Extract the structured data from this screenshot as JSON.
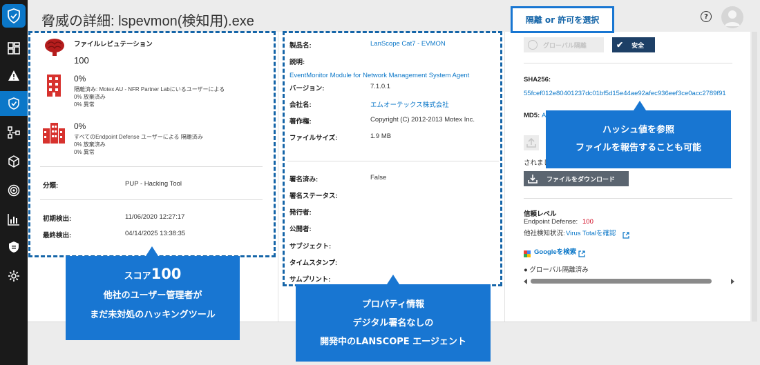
{
  "page": {
    "title": "脅威の詳細: lspevmon(検知用).exe"
  },
  "left_panel": {
    "reputation_title": "ファイルレピュテーション",
    "score": "100",
    "partner": {
      "percent": "0%",
      "desc": "隔離済み: Motex AU - NFR Partner Labにいるユーザーによる",
      "allowed": "0% 放棄済み",
      "anomaly": "0% 異常"
    },
    "all_users": {
      "percent": "0%",
      "desc": "すべてのEndpoint Defense ユーザーによる 隔離済み",
      "allowed": "0% 放棄済み",
      "anomaly": "0% 異常"
    },
    "classification_label": "分類:",
    "classification_value": "PUP - Hacking Tool",
    "first_seen_label": "初期検出:",
    "first_seen_value": "11/06/2020 12:27:17",
    "last_seen_label": "最終検出:",
    "last_seen_value": "04/14/2025 13:38:35"
  },
  "middle_panel": {
    "product_label": "製品名:",
    "product_value": "LanScope Cat7 - EVMON",
    "desc_label": "説明:",
    "desc_value": "EventMonitor Module for Network Management System Agent",
    "version_label": "バージョン:",
    "version_value": "7.1.0.1",
    "company_label": "会社名:",
    "company_value": "エムオーテックス株式会社",
    "copyright_label": "著作権:",
    "copyright_value": "Copyright (C) 2012-2013 Motex Inc.",
    "size_label": "ファイルサイズ:",
    "size_value": "1.9 MB",
    "signed_label": "署名済み:",
    "signed_value": "False",
    "sig_status_label": "署名ステータス:",
    "issuer_label": "発行者:",
    "publisher_label": "公開者:",
    "subject_label": "サブジェクト:",
    "timestamp_label": "タイムスタンプ:",
    "thumbprint_label": "サムプリント:"
  },
  "right_panel": {
    "global_btn": "グローバル隔離",
    "safe_btn": "安全",
    "sha_label": "SHA256:",
    "sha_value": "55fcef012e80401237dc01bf5d15e44ae92afec936eef3ce0acc2789f91",
    "md5_label": "MD5:",
    "md5_value_partial": "A",
    "partial_text": "されまし",
    "download_btn": "ファイルをダウンロード",
    "trust_title": "信頼レベル",
    "trust_ed_label": "Endpoint Defense:",
    "trust_ed_value": "100",
    "trust_other_label": "他社検知状況:",
    "trust_other_link": "Virus Totalを確認",
    "google_link": "Googleを検索",
    "bullet_text": "グローバル隔離済み"
  },
  "callouts": {
    "top_right": "隔離 or 許可を選択",
    "hash_line1": "ハッシュ値を参照",
    "hash_line2": "ファイルを報告することも可能",
    "score_line1_prefix": "スコア",
    "score_line1_num": "100",
    "score_line2": "他社のユーザー管理者が",
    "score_line3": "まだ未対処のハッキングツール",
    "prop_line1": "プロパティ情報",
    "prop_line2": "デジタル署名なしの",
    "prop_line3": "開発中のLANSCOPE エージェント"
  },
  "colors": {
    "accent": "#0b77c8",
    "callout": "#1876d2",
    "dark_button": "#1d3f66",
    "score_red": "#d0021b"
  }
}
